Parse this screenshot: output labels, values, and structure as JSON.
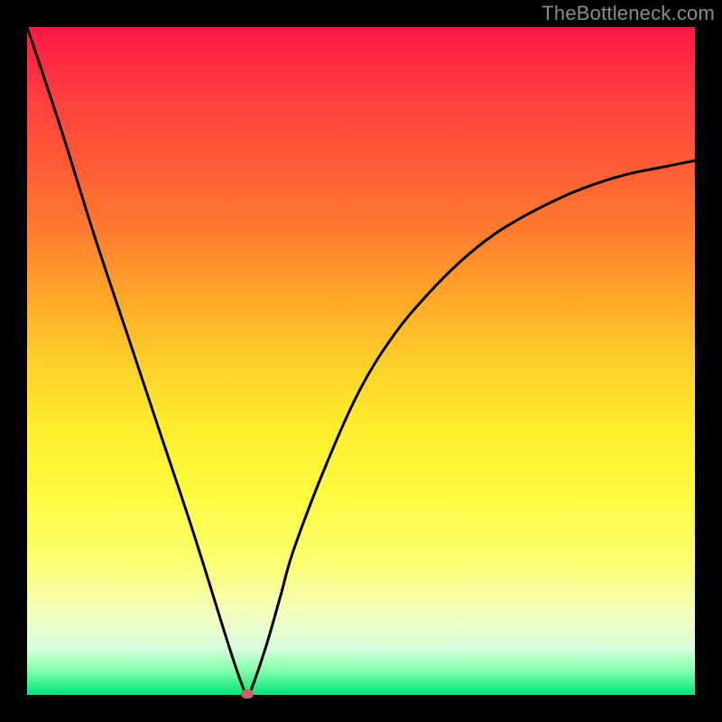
{
  "watermark": "TheBottleneck.com",
  "chart_data": {
    "type": "line",
    "title": "",
    "xlabel": "",
    "ylabel": "",
    "xlim": [
      0,
      100
    ],
    "ylim": [
      0,
      100
    ],
    "grid": false,
    "series": [
      {
        "name": "bottleneck-curve",
        "x": [
          0,
          5,
          10,
          15,
          20,
          25,
          30,
          32,
          33,
          34,
          36,
          38,
          40,
          45,
          50,
          55,
          60,
          65,
          70,
          75,
          80,
          85,
          90,
          95,
          100
        ],
        "values": [
          100,
          85,
          69,
          54,
          39,
          24,
          8,
          2,
          0,
          2,
          8,
          15,
          22,
          35,
          46,
          54,
          60,
          65,
          69,
          72,
          74.5,
          76.5,
          78,
          79,
          80
        ]
      }
    ],
    "marker": {
      "x": 33,
      "y": 0,
      "color": "#c86464"
    },
    "background_gradient": {
      "top": "#ff1744",
      "mid": "#ffee2e",
      "bottom": "#00E676"
    }
  }
}
